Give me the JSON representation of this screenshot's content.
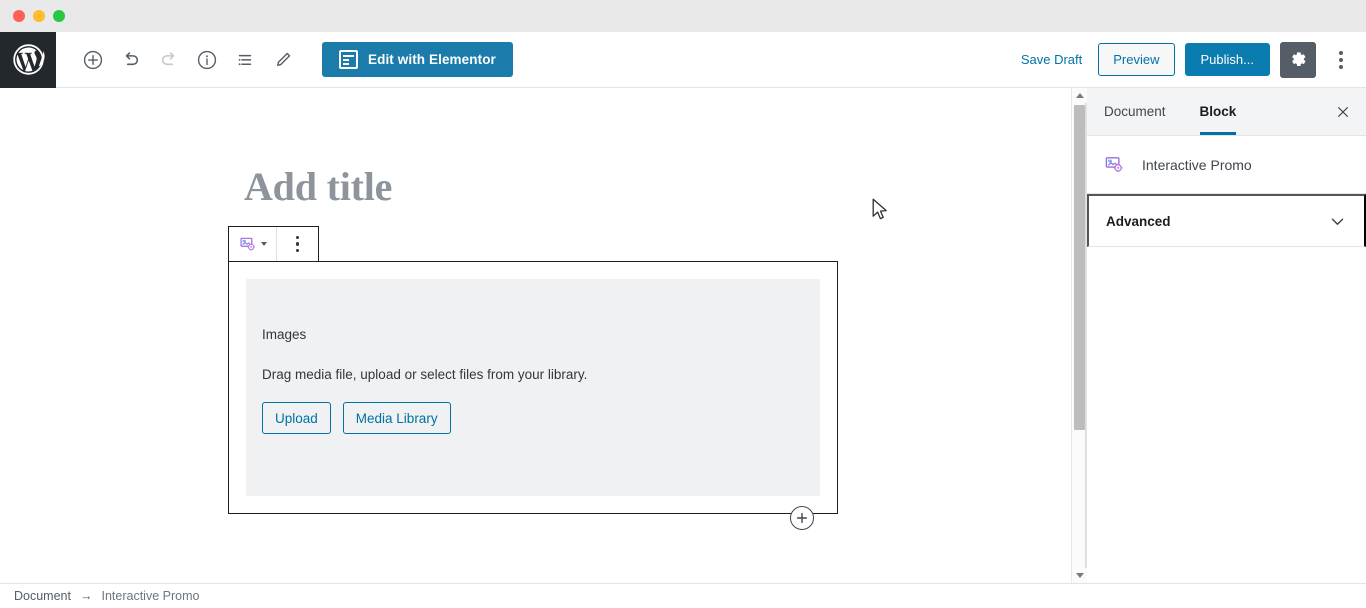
{
  "window": {
    "traffic_lights": [
      "close",
      "minimize",
      "zoom"
    ]
  },
  "toolbar": {
    "logo_name": "wordpress-logo",
    "add_block_label": "Add block",
    "undo_label": "Undo",
    "redo_label": "Redo",
    "info_label": "Content structure",
    "list_view_label": "Block navigation",
    "edit_label": "Edit",
    "elementor_label": "Edit with Elementor",
    "save_draft_label": "Save Draft",
    "preview_label": "Preview",
    "publish_label": "Publish...",
    "settings_label": "Settings",
    "more_label": "More tools & options"
  },
  "canvas": {
    "title_placeholder": "Add title",
    "block": {
      "type_icon_name": "interactive-promo-icon",
      "placeholder_label": "Images",
      "placeholder_description": "Drag media file, upload or select files from your library.",
      "upload_label": "Upload",
      "media_library_label": "Media Library"
    },
    "appender_label": "Add block"
  },
  "sidebar": {
    "tabs": [
      {
        "label": "Document",
        "active": false
      },
      {
        "label": "Block",
        "active": true
      }
    ],
    "close_label": "Close settings",
    "block_name": "Interactive Promo",
    "block_icon_name": "interactive-promo-icon",
    "panels": [
      {
        "label": "Advanced",
        "expanded": false
      }
    ]
  },
  "footer": {
    "breadcrumbs": [
      "Document",
      "Interactive Promo"
    ],
    "separator": "→"
  },
  "colors": {
    "wp_admin_dark": "#23282d",
    "accent_blue": "#0071a1",
    "publish_blue": "#0b7cb0",
    "elementor_blue": "#1b7cac",
    "gear_active": "#555d66",
    "block_border": "#1e1e1e",
    "placeholder_bg": "#f0f1f2",
    "block_icon_purple": "#8c66d9"
  }
}
